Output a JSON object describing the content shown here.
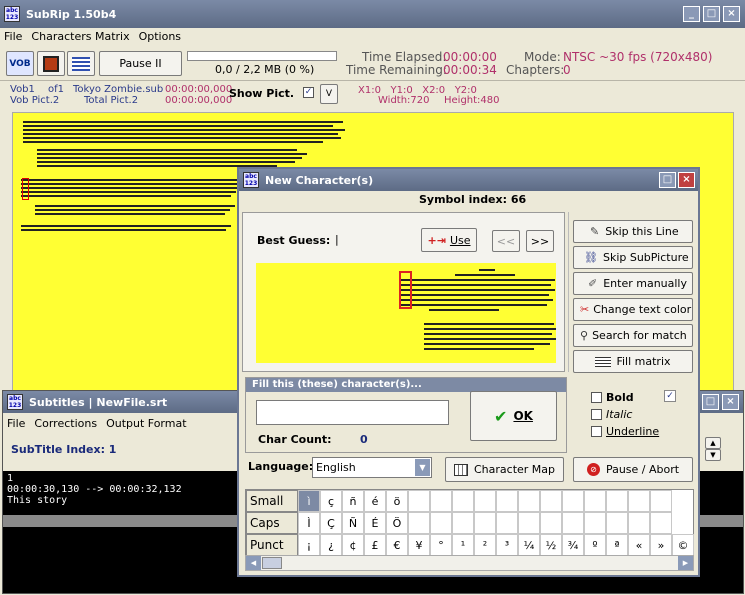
{
  "main_window": {
    "title": "SubRip 1.50b4",
    "menu": [
      "File",
      "Characters Matrix",
      "Options"
    ],
    "pause_label": "Pause II",
    "progress_text": "0,0 / 2,2 MB (0 %)",
    "time_elapsed_label": "Time Elapsed:",
    "time_elapsed": "00:00:00",
    "time_remaining_label": "Time Remaining:",
    "time_remaining": "00:00:34",
    "mode_label": "Mode:",
    "mode": "NTSC ~30 fps (720x480)",
    "chapters_label": "Chapters:",
    "chapters": "0",
    "vob_label": "Vob1",
    "vob_of": "of1",
    "filename": "Tokyo Zombie.sub",
    "file_time": "00:00:00,000",
    "vob_pict_label": "Vob Pict.2",
    "total_pict_label": "Total Pict.2",
    "total_time": "00:00:00,000",
    "show_pict_label": "Show Pict.",
    "show_pict_checked": true,
    "dropdown_glyph": "V",
    "coords_top": "X1:0   Y1:0   X2:0   Y2:0",
    "width_label": "Width:720",
    "height_label": "Height:480",
    "accent_yellow": "#ffff33"
  },
  "subtitles_window": {
    "title": "Subtitles | NewFile.srt",
    "menu": [
      "File",
      "Corrections",
      "Output Format"
    ],
    "subtitle_index_label": "SubTitle Index: 1",
    "entry_number": "1",
    "entry_time": "00:00:30,130 --> 00:00:32,132",
    "entry_text": "This story"
  },
  "dialog": {
    "title": "New Character(s)",
    "symbol_index": "Symbol index: 66",
    "best_guess_label": "Best Guess:",
    "best_guess_value": "|",
    "use_label": "Use",
    "prev_label": "<<",
    "next_label": ">>",
    "fill_header": "Fill this (these) character(s)...",
    "fill_value": "",
    "char_count_label": "Char Count:",
    "char_count": "0",
    "ok_label": "OK",
    "language_label": "Language:",
    "language_value": "English",
    "character_map_label": "Character Map",
    "pause_abort_label": "Pause / Abort",
    "side_buttons": [
      "Skip this Line",
      "Skip SubPicture",
      "Enter manually",
      "Change text color",
      "Search for match",
      "Fill matrix"
    ],
    "bold_label": "Bold",
    "italic_label": "Italic",
    "underline_label": "Underline",
    "bold_checked": false,
    "italic_checked": false,
    "underline_checked": false,
    "grid_rows": [
      {
        "label": "Small",
        "chars": [
          "ì",
          "ç",
          "ñ",
          "é",
          "ö",
          "",
          "",
          "",
          "",
          "",
          "",
          "",
          "",
          "",
          "",
          "",
          ""
        ]
      },
      {
        "label": "Caps",
        "chars": [
          "Ì",
          "Ç",
          "Ñ",
          "É",
          "Ö",
          "",
          "",
          "",
          "",
          "",
          "",
          "",
          "",
          "",
          "",
          "",
          ""
        ]
      },
      {
        "label": "Punct",
        "chars": [
          "¡",
          "¿",
          "¢",
          "£",
          "€",
          "¥",
          "°",
          "¹",
          "²",
          "³",
          "¼",
          "½",
          "¾",
          "º",
          "ª",
          "«",
          "»",
          "©"
        ]
      }
    ]
  }
}
